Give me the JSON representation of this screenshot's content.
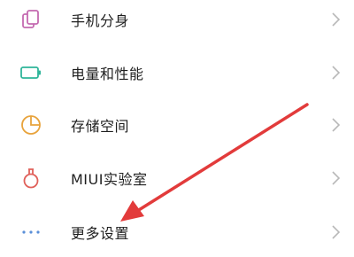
{
  "settings": {
    "items": [
      {
        "label": "手机分身",
        "icon": "dual-apps-icon",
        "icon_color": "#c46ab0"
      },
      {
        "label": "电量和性能",
        "icon": "battery-icon",
        "icon_color": "#2fb59a"
      },
      {
        "label": "存储空间",
        "icon": "storage-pie-icon",
        "icon_color": "#e8a33c"
      },
      {
        "label": "MIUI实验室",
        "icon": "lab-flask-icon",
        "icon_color": "#e0605a"
      },
      {
        "label": "更多设置",
        "icon": "more-dots-icon",
        "icon_color": "#5a8fd8"
      }
    ]
  },
  "colors": {
    "chevron": "#b8b8b8",
    "annotation_arrow": "#e23b3b"
  }
}
